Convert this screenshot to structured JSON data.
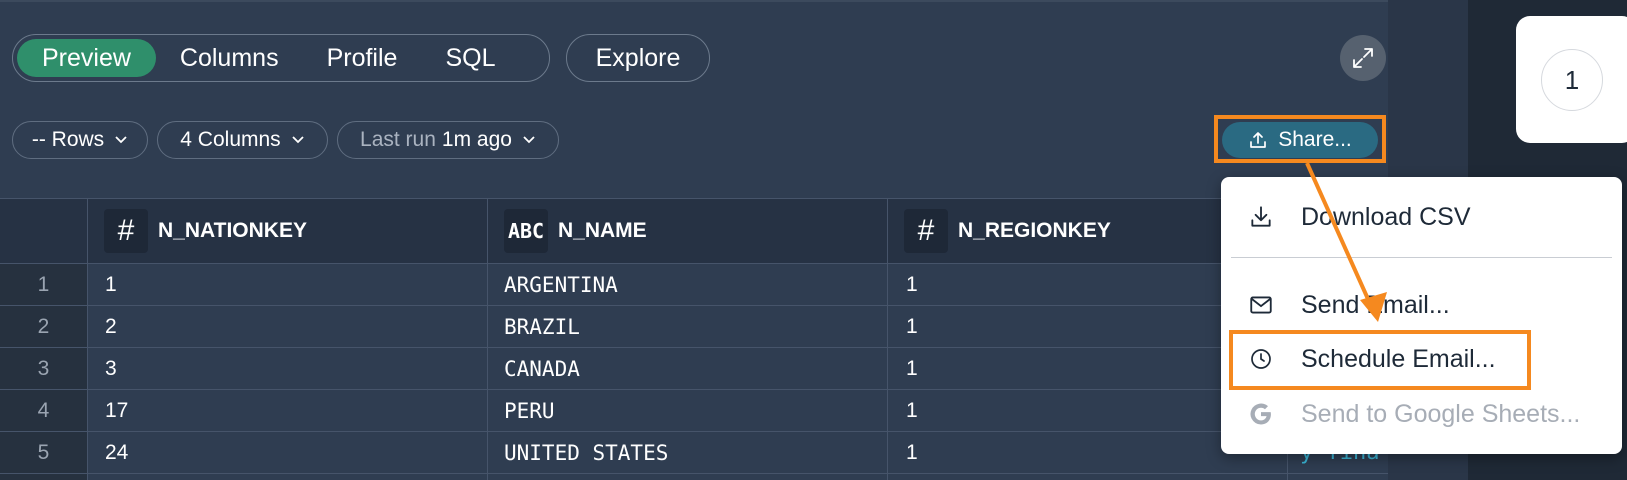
{
  "tabs": [
    {
      "label": "Preview",
      "active": true
    },
    {
      "label": "Columns",
      "active": false
    },
    {
      "label": "Profile",
      "active": false
    },
    {
      "label": "SQL",
      "active": false
    }
  ],
  "explore_label": "Explore",
  "filters": {
    "rows_label": "-- Rows",
    "columns_label": "4 Columns",
    "last_run_prefix": "Last run",
    "last_run_value": "1m ago"
  },
  "share_label": "Share...",
  "side_panel": {
    "value": "1"
  },
  "table": {
    "columns": [
      {
        "name": "N_NATIONKEY",
        "type_icon": "#"
      },
      {
        "name": "N_NAME",
        "type_icon": "ABC"
      },
      {
        "name": "N_REGIONKEY",
        "type_icon": "#"
      }
    ],
    "rows": [
      {
        "num": "1",
        "key": "1",
        "name": "ARGENTINA",
        "region": "1"
      },
      {
        "num": "2",
        "key": "2",
        "name": "BRAZIL",
        "region": "1"
      },
      {
        "num": "3",
        "key": "3",
        "name": "CANADA",
        "region": "1"
      },
      {
        "num": "4",
        "key": "17",
        "name": "PERU",
        "region": "1"
      },
      {
        "num": "5",
        "key": "24",
        "name": "UNITED STATES",
        "region": "1"
      }
    ],
    "clipped_comment": "y fina"
  },
  "share_menu": {
    "items": [
      {
        "label": "Download CSV",
        "icon": "download-icon",
        "disabled": false
      },
      {
        "label": "Send Email...",
        "icon": "envelope-icon",
        "disabled": false
      },
      {
        "label": "Schedule Email...",
        "icon": "clock-icon",
        "disabled": false
      },
      {
        "label": "Send to Google Sheets...",
        "icon": "google-icon",
        "disabled": true
      }
    ]
  },
  "colors": {
    "accent_active_tab": "#2f8f6b",
    "share_button": "#2a6a82",
    "highlight": "#f5891f"
  }
}
